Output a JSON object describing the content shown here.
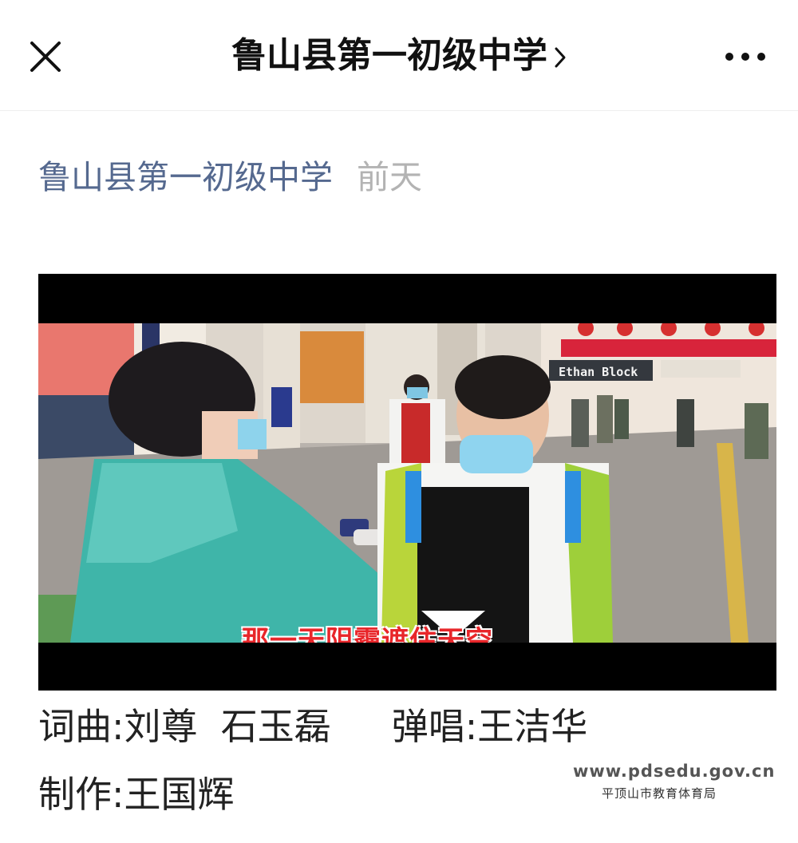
{
  "header": {
    "title": "鲁山县第一初级中学",
    "close_icon": "close-icon",
    "more_icon": "more-icon",
    "chevron_icon": "chevron-right-icon"
  },
  "post": {
    "author": "鲁山县第一初级中学",
    "time": "前天"
  },
  "video": {
    "subtitle": "那一天阴霾遮住天空,",
    "sign_text": "Ethan Block"
  },
  "credits": {
    "lyrics_label": "词曲:",
    "lyrics_names": "刘尊  石玉磊",
    "singer_label": "弹唱:",
    "singer_name": "王洁华",
    "producer_label": "制作:",
    "producer_name": "王国辉"
  },
  "watermark": {
    "url": "www.pdsedu.gov.cn",
    "org": "平顶山市教育体育局"
  },
  "colors": {
    "author_link": "#55698f",
    "time_gray": "#b3b3b3",
    "subtitle_red": "#e8262a"
  }
}
